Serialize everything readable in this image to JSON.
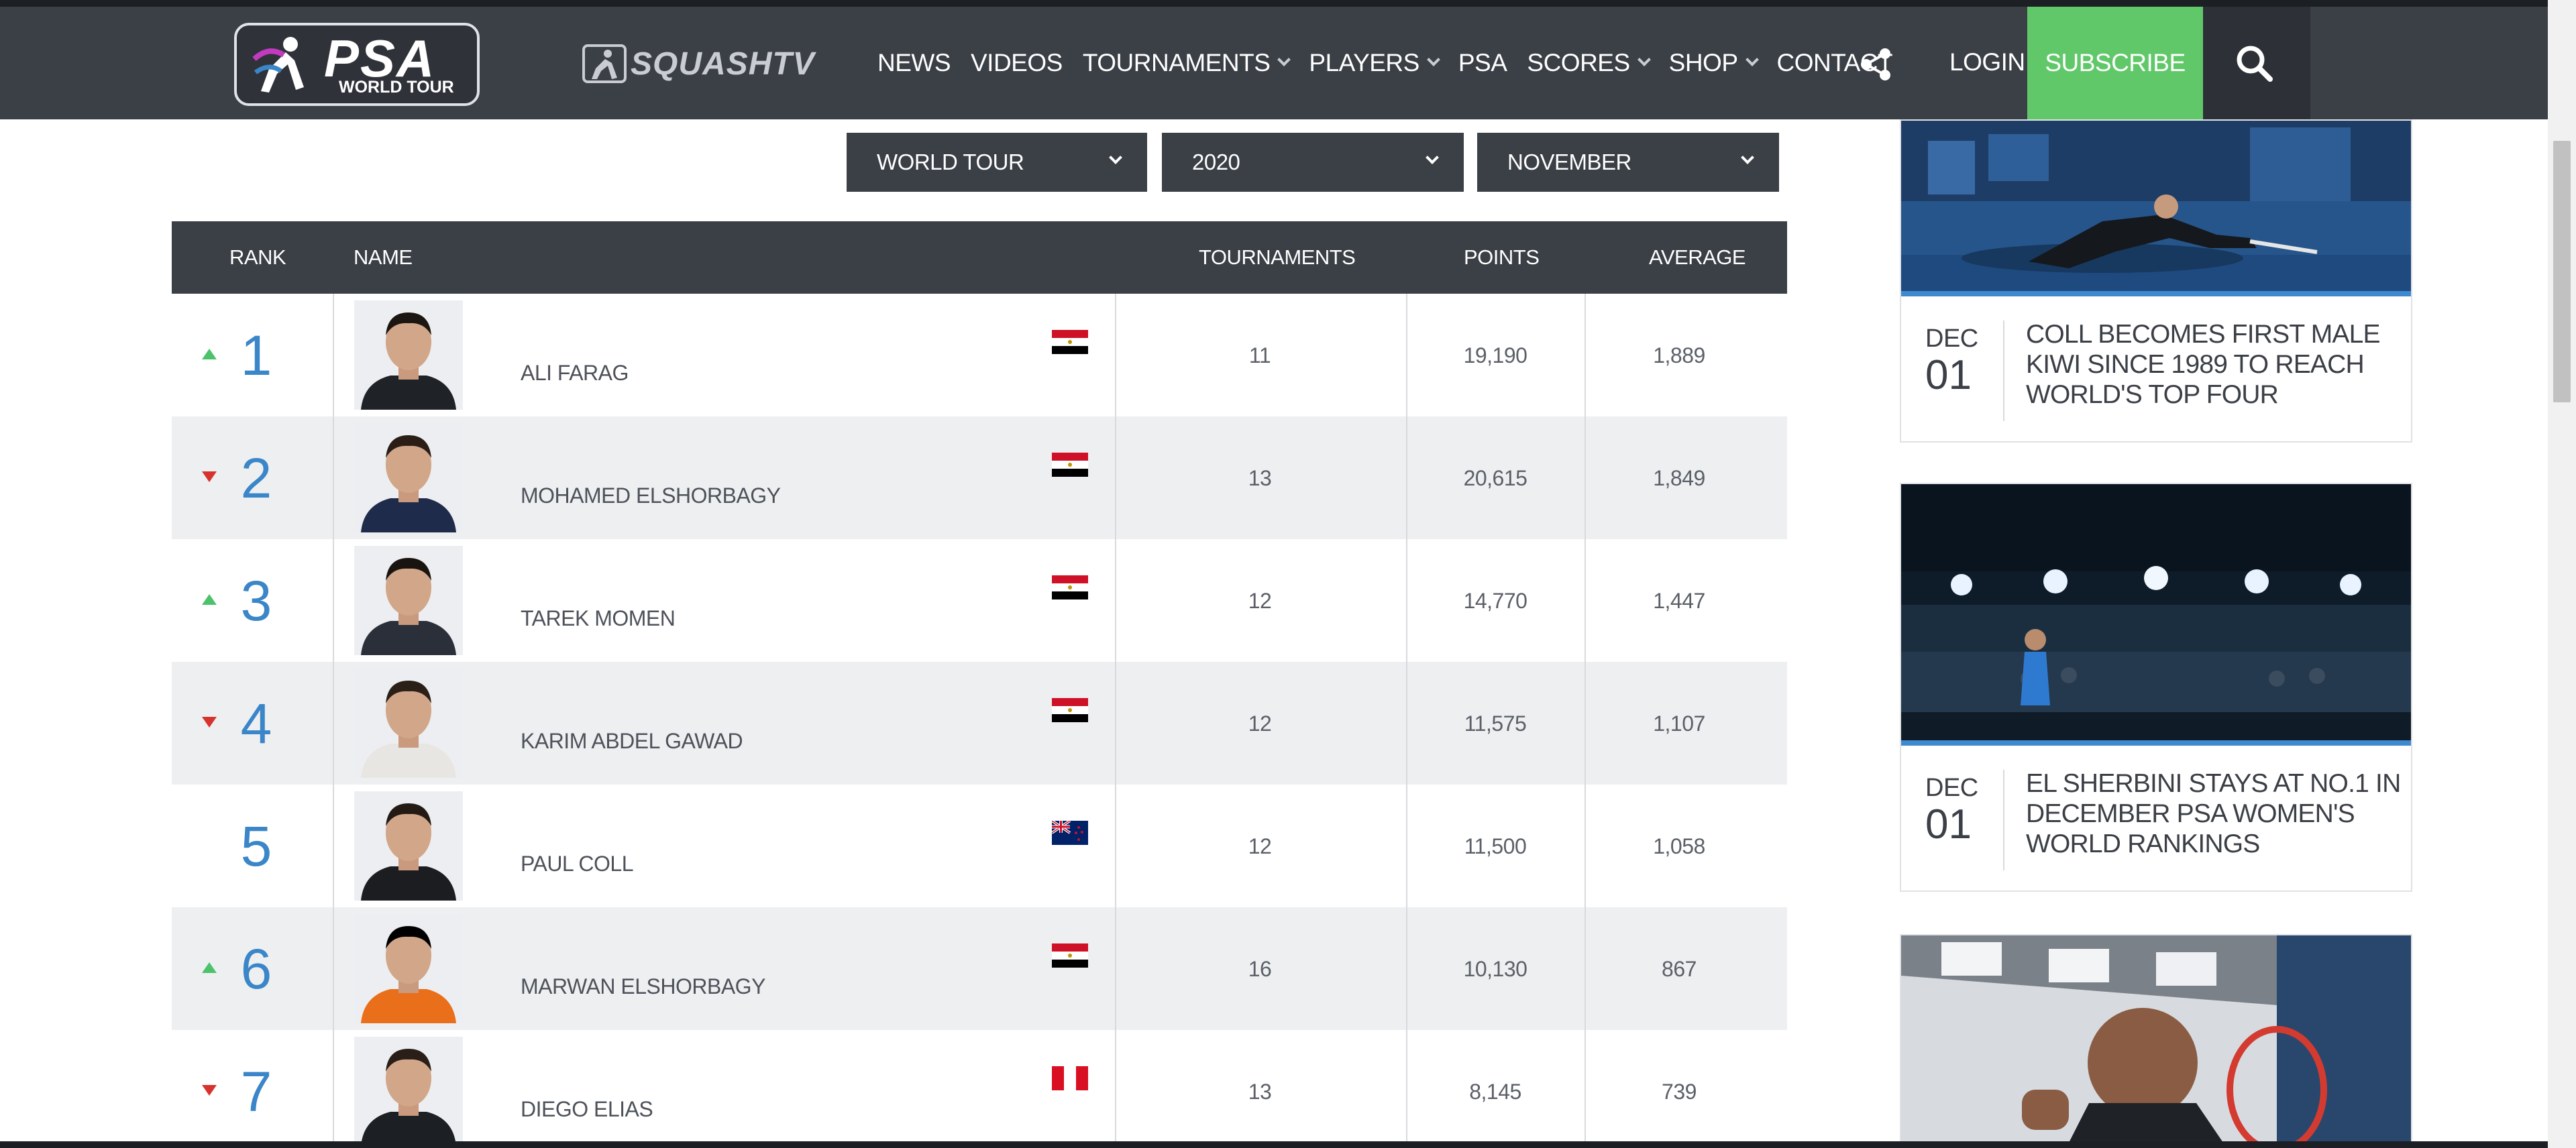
{
  "nav": {
    "logo_text": "PSA",
    "logo_sub": "WORLD TOUR",
    "squashtv_text": "SQUASHTV",
    "links": [
      {
        "label": "NEWS",
        "dropdown": false
      },
      {
        "label": "VIDEOS",
        "dropdown": false
      },
      {
        "label": "TOURNAMENTS",
        "dropdown": true
      },
      {
        "label": "PLAYERS",
        "dropdown": true
      },
      {
        "label": "PSA",
        "dropdown": false
      },
      {
        "label": "SCORES",
        "dropdown": true
      },
      {
        "label": "SHOP",
        "dropdown": true
      },
      {
        "label": "CONTACT",
        "dropdown": false
      }
    ],
    "share_icon": "share-icon",
    "login": "LOGIN",
    "subscribe": "SUBSCRIBE",
    "search_icon": "search-icon",
    "subscribe_color": "#61c86a"
  },
  "filters": {
    "tour": "WORLD TOUR",
    "year": "2020",
    "month": "NOVEMBER"
  },
  "table": {
    "headers": {
      "rank": "RANK",
      "name": "NAME",
      "tournaments": "TOURNAMENTS",
      "points": "POINTS",
      "average": "AVERAGE"
    },
    "rows": [
      {
        "rank": "1",
        "movement": "up",
        "name": "ALI FARAG",
        "country": "egypt",
        "tournaments": "11",
        "points": "19,190",
        "average": "1,889"
      },
      {
        "rank": "2",
        "movement": "down",
        "name": "MOHAMED ELSHORBAGY",
        "country": "egypt",
        "tournaments": "13",
        "points": "20,615",
        "average": "1,849"
      },
      {
        "rank": "3",
        "movement": "up",
        "name": "TAREK MOMEN",
        "country": "egypt",
        "tournaments": "12",
        "points": "14,770",
        "average": "1,447"
      },
      {
        "rank": "4",
        "movement": "down",
        "name": "KARIM ABDEL GAWAD",
        "country": "egypt",
        "tournaments": "12",
        "points": "11,575",
        "average": "1,107"
      },
      {
        "rank": "5",
        "movement": "none",
        "name": "PAUL COLL",
        "country": "new-zealand",
        "tournaments": "12",
        "points": "11,500",
        "average": "1,058"
      },
      {
        "rank": "6",
        "movement": "up",
        "name": "MARWAN ELSHORBAGY",
        "country": "egypt",
        "tournaments": "16",
        "points": "10,130",
        "average": "867"
      },
      {
        "rank": "7",
        "movement": "down",
        "name": "DIEGO ELIAS",
        "country": "peru",
        "tournaments": "13",
        "points": "8,145",
        "average": "739"
      }
    ],
    "colors": {
      "up": "#4cc26a",
      "down": "#d6332f",
      "rank": "#3a86c8"
    }
  },
  "news": [
    {
      "month": "DEC",
      "day": "01",
      "title": "COLL BECOMES FIRST MALE KIWI SINCE 1989 TO REACH WORLD'S TOP FOUR"
    },
    {
      "month": "DEC",
      "day": "01",
      "title": "EL SHERBINI STAYS AT NO.1 IN DECEMBER PSA WOMEN'S WORLD RANKINGS"
    }
  ]
}
